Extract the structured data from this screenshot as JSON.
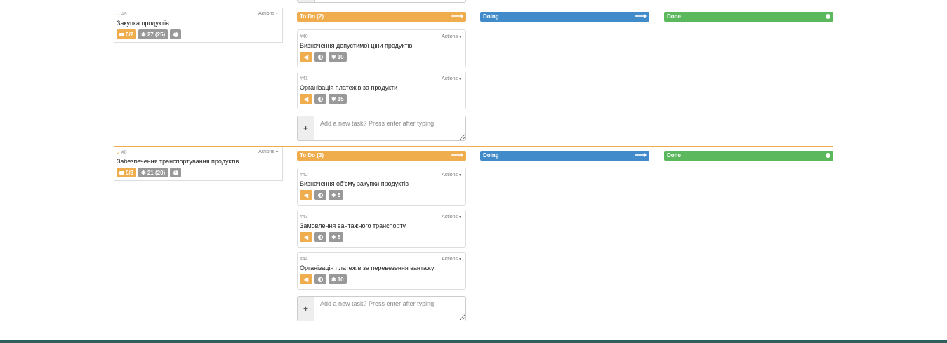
{
  "stories": [
    {
      "number": "#9",
      "title": "Закупка продуктів",
      "actions_label": "Actions",
      "badges": {
        "tasks": "0/2",
        "points": "27 (25)"
      },
      "columns": {
        "todo": "To Do (2)",
        "doing": "Doing",
        "done": "Done"
      },
      "tasks": [
        {
          "number": "#40",
          "title": "Визначення допустимої ціни продуктів",
          "actions_label": "Actions",
          "points": "10"
        },
        {
          "number": "#41",
          "title": "Організація платежів за продукти",
          "actions_label": "Actions",
          "points": "15"
        }
      ],
      "add_task_placeholder": "Add a new task? Press enter after typing!"
    },
    {
      "number": "#8",
      "title": "Забезпечення транспортування продуктів",
      "actions_label": "Actions",
      "badges": {
        "tasks": "0/3",
        "points": "21 (20)"
      },
      "columns": {
        "todo": "To Do (3)",
        "doing": "Doing",
        "done": "Done"
      },
      "tasks": [
        {
          "number": "#42",
          "title": "Визначення об'єму закупки продуктів",
          "actions_label": "Actions",
          "points": "5"
        },
        {
          "number": "#43",
          "title": "Замовлення вантажного транспорту",
          "actions_label": "Actions",
          "points": "5"
        },
        {
          "number": "#44",
          "title": "Організація платежів за перевезення вантажу",
          "actions_label": "Actions",
          "points": "10"
        }
      ],
      "add_task_placeholder": "Add a new task? Press enter after typing!"
    }
  ],
  "colors": {
    "todo": "#f0ad4e",
    "doing": "#428bca",
    "done": "#5cb85c",
    "badge_gray": "#999999",
    "footer": "#2f5f5f"
  }
}
